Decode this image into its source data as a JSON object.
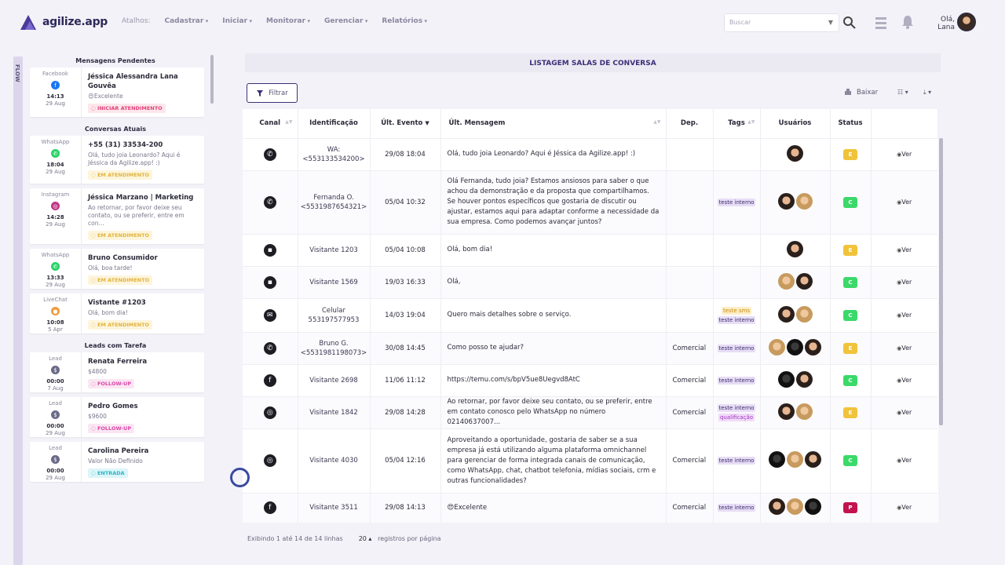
{
  "brand": {
    "name": "agilize.app"
  },
  "nav": {
    "shortcut": "Atalhos:",
    "items": [
      "Cadastrar",
      "Iniciar",
      "Monitorar",
      "Gerenciar",
      "Relatórios"
    ]
  },
  "search": {
    "placeholder": "Buscar"
  },
  "user": {
    "greeting": "Olá,",
    "name": "Lana"
  },
  "flow_tab": "FLOW",
  "sidebar": {
    "pending_title": "Mensagens Pendentes",
    "current_title": "Conversas Atuais",
    "leads_title": "Leads com Tarefa",
    "pending": [
      {
        "source": "Facebook",
        "time": "14:13",
        "date": "29 Aug",
        "name": "Jéssica Alessandra Lana Gouvêa",
        "msg": "😍Excelente",
        "badge": "INICIAR ATENDIMENTO"
      }
    ],
    "current": [
      {
        "source": "WhatsApp",
        "time": "18:04",
        "date": "29 Aug",
        "name": "+55 (31) 33534-200",
        "msg": "Olá, tudo joia Leonardo? Aqui é Jéssica da Agilize.app! :)",
        "badge": "EM ATENDIMENTO"
      },
      {
        "source": "Instagram",
        "time": "14:28",
        "date": "29 Aug",
        "name": "Jéssica Marzano | Marketing",
        "msg": "Ao retornar, por favor deixe seu contato, ou se preferir, entre em con...",
        "badge": "EM ATENDIMENTO"
      },
      {
        "source": "WhatsApp",
        "time": "13:33",
        "date": "29 Aug",
        "name": "Bruno Consumidor",
        "msg": "Olá, boa tarde!",
        "badge": "EM ATENDIMENTO"
      },
      {
        "source": "LiveChat",
        "time": "10:08",
        "date": "5 Apr",
        "name": "Vistante #1203",
        "msg": "Olá, bom dia!",
        "badge": "EM ATENDIMENTO"
      }
    ],
    "leads": [
      {
        "source": "Lead",
        "time": "00:00",
        "date": "7 Aug",
        "name": "Renata Ferreira",
        "msg": "$4800",
        "badge": "FOLLOW-UP"
      },
      {
        "source": "Lead",
        "time": "00:00",
        "date": "29 Aug",
        "name": "Pedro Gomes",
        "msg": "$9600",
        "badge": "FOLLOW-UP"
      },
      {
        "source": "Lead",
        "time": "00:00",
        "date": "29 Aug",
        "name": "Carolina Pereira",
        "msg": "Valor Não Definido",
        "badge": "ENTRADA"
      }
    ]
  },
  "main": {
    "title": "LISTAGEM SALAS DE CONVERSA",
    "filter_label": "Filtrar",
    "download_label": "Baixar",
    "columns": [
      "Canal",
      "Identificação",
      "Últ. Evento",
      "Últ. Mensagem",
      "Dep.",
      "Tags",
      "Usuários",
      "Status",
      ""
    ],
    "rows": [
      {
        "channel": "whatsapp",
        "id": "WA:\n<553133534200>",
        "event": "29/08 18:04",
        "msg": "Olá, tudo joia Leonardo? Aqui é Jéssica da Agilize.app! :)",
        "dep": "",
        "tags": [],
        "users": [
          "a"
        ],
        "status": "E"
      },
      {
        "channel": "whatsapp",
        "id": "Fernanda O.\n<5531987654321>",
        "event": "05/04 10:32",
        "msg": "Olá Fernanda, tudo joia? Estamos ansiosos para saber o que achou da demonstração e da proposta que compartilhamos. Se houver pontos específicos que gostaria de discutir ou ajustar, estamos aqui para adaptar conforme a necessidade da sua empresa. Como podemos avançar juntos?",
        "dep": "",
        "tags": [
          "teste interno"
        ],
        "users": [
          "a",
          "b"
        ],
        "status": "C"
      },
      {
        "channel": "livechat",
        "id": "Visitante 1203",
        "event": "05/04 10:08",
        "msg": "Olá, bom dia!",
        "dep": "",
        "tags": [],
        "users": [
          "a"
        ],
        "status": "E"
      },
      {
        "channel": "livechat",
        "id": "Visitante 1569",
        "event": "19/03 16:33",
        "msg": "Olá,",
        "dep": "",
        "tags": [],
        "users": [
          "b",
          "a"
        ],
        "status": "C"
      },
      {
        "channel": "sms",
        "id": "Celular\n553197577953",
        "event": "14/03 19:04",
        "msg": "Quero mais detalhes sobre o serviço.",
        "dep": "",
        "tags": [
          "teste sms",
          "teste interno"
        ],
        "users": [
          "a",
          "b"
        ],
        "status": "C"
      },
      {
        "channel": "whatsapp",
        "id": "Bruno G.\n<5531981198073>",
        "event": "30/08 14:45",
        "msg": "Como posso te ajudar?",
        "dep": "Comercial",
        "tags": [
          "teste interno"
        ],
        "users": [
          "b",
          "c",
          "a"
        ],
        "status": "E"
      },
      {
        "channel": "facebook",
        "id": "Visitante 2698",
        "event": "11/06 11:12",
        "msg": "https://temu.com/s/bpV5ue8Uegvd8AtC",
        "dep": "Comercial",
        "tags": [
          "teste interno"
        ],
        "users": [
          "c",
          "a"
        ],
        "status": "C"
      },
      {
        "channel": "instagram",
        "id": "Visitante 1842",
        "event": "29/08 14:28",
        "msg": "Ao retornar, por favor deixe seu contato, ou se preferir, entre em contato conosco pelo WhatsApp no número 02140637007...",
        "dep": "Comercial",
        "tags": [
          "teste interno",
          "qualificação"
        ],
        "users": [
          "a",
          "b"
        ],
        "status": "E"
      },
      {
        "channel": "instagram",
        "id": "Visitante 4030",
        "event": "05/04 12:16",
        "msg": "Aproveitando a oportunidade, gostaria de saber se a sua empresa já está utilizando alguma plataforma omnichannel para gerenciar de forma integrada canais de comunicação, como WhatsApp, chat, chatbot telefonia, mídias sociais, crm e outras funcionalidades?",
        "dep": "Comercial",
        "tags": [
          "teste interno"
        ],
        "users": [
          "c",
          "b",
          "a"
        ],
        "status": "C"
      },
      {
        "channel": "facebook",
        "id": "Visitante 3511",
        "event": "29/08 14:13",
        "msg": "😍Excelente",
        "dep": "Comercial",
        "tags": [
          "teste interno"
        ],
        "users": [
          "a",
          "b",
          "c"
        ],
        "status": "P"
      }
    ],
    "view_label": "Ver",
    "footer_info": "Exibindo 1 até 14 de 14 linhas",
    "page_size": "20",
    "page_size_label": "registros por página"
  }
}
